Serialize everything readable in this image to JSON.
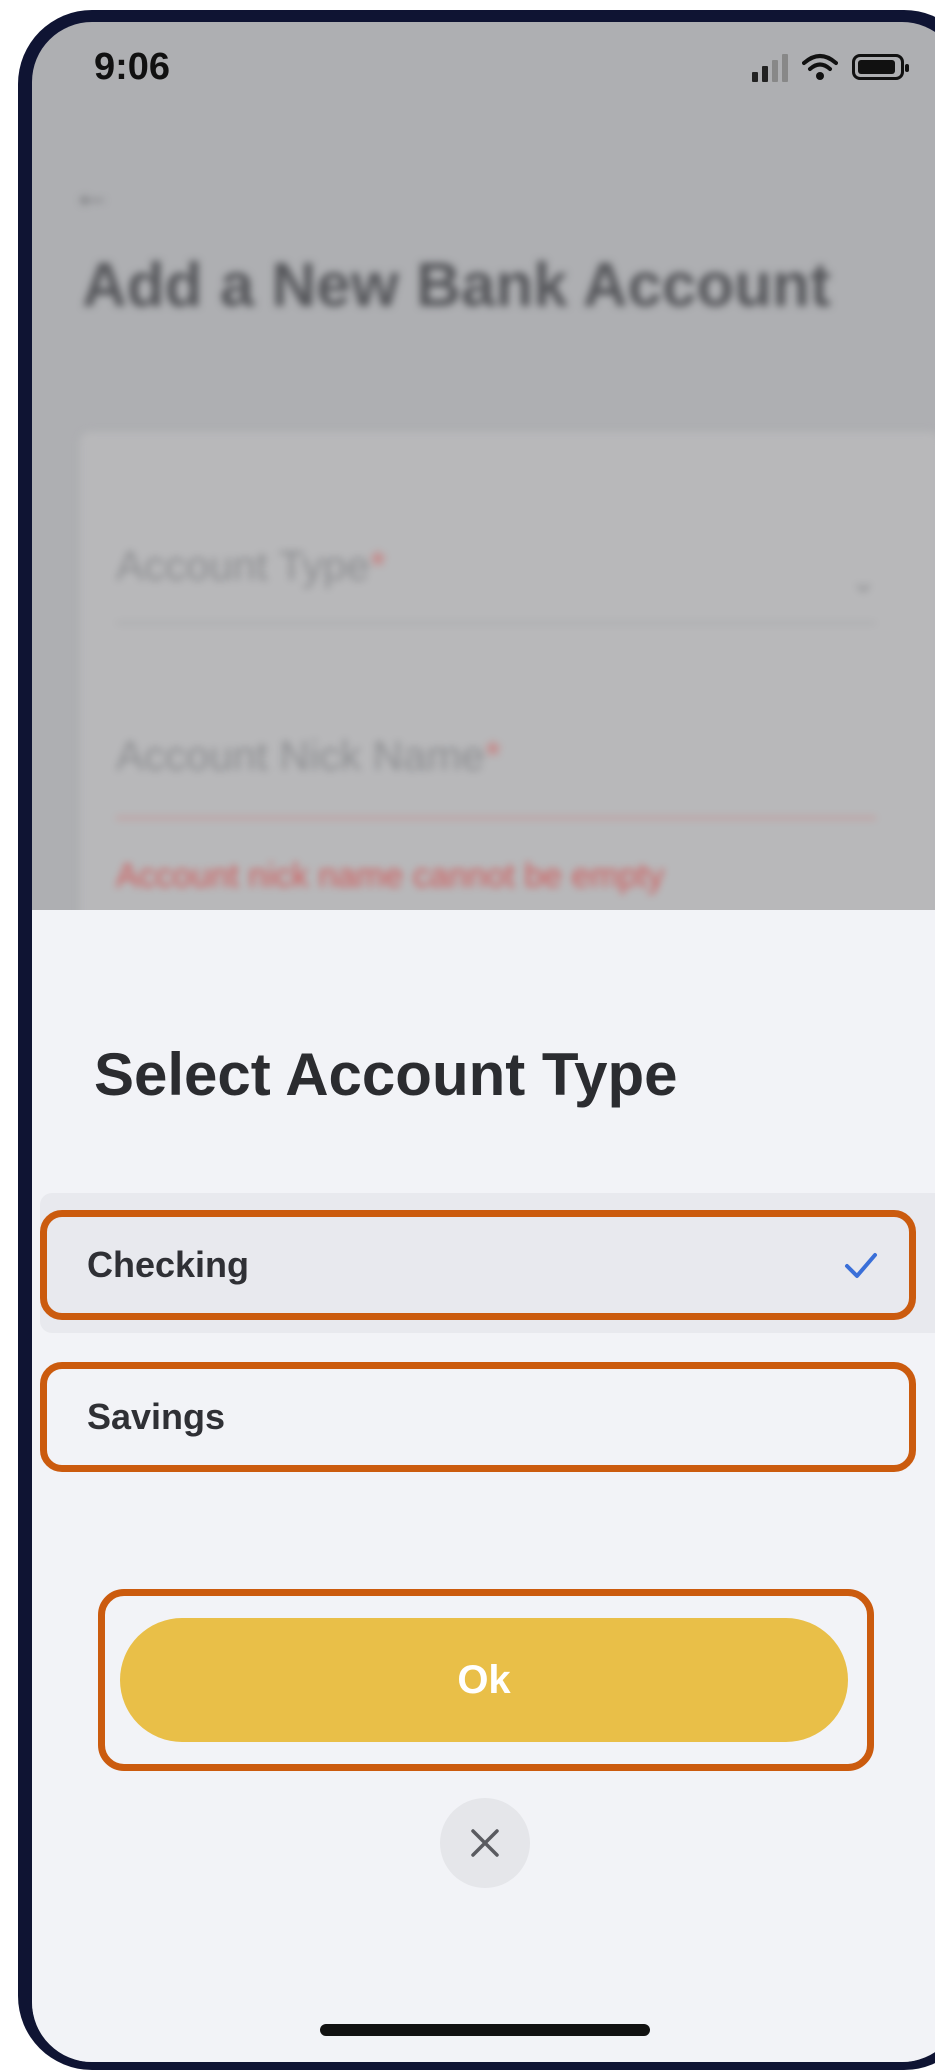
{
  "status_bar": {
    "time": "9:06"
  },
  "background_page": {
    "back_icon": "back-arrow-icon",
    "title": "Add a New Bank Account",
    "fields": [
      {
        "label": "Account Type",
        "required_mark": "*"
      },
      {
        "label": "Account Nick Name",
        "required_mark": "*"
      }
    ],
    "error_text": "Account nick name cannot be empty"
  },
  "sheet": {
    "title": "Select Account Type",
    "options": [
      {
        "label": "Checking",
        "selected": true
      },
      {
        "label": "Savings",
        "selected": false
      }
    ],
    "ok_label": "Ok",
    "close_icon": "close-icon"
  },
  "colors": {
    "accent_yellow": "#e9bf48",
    "highlight_orange": "#cb5b0e",
    "check_blue": "#3a6fd8",
    "sheet_bg": "#f2f3f7"
  }
}
